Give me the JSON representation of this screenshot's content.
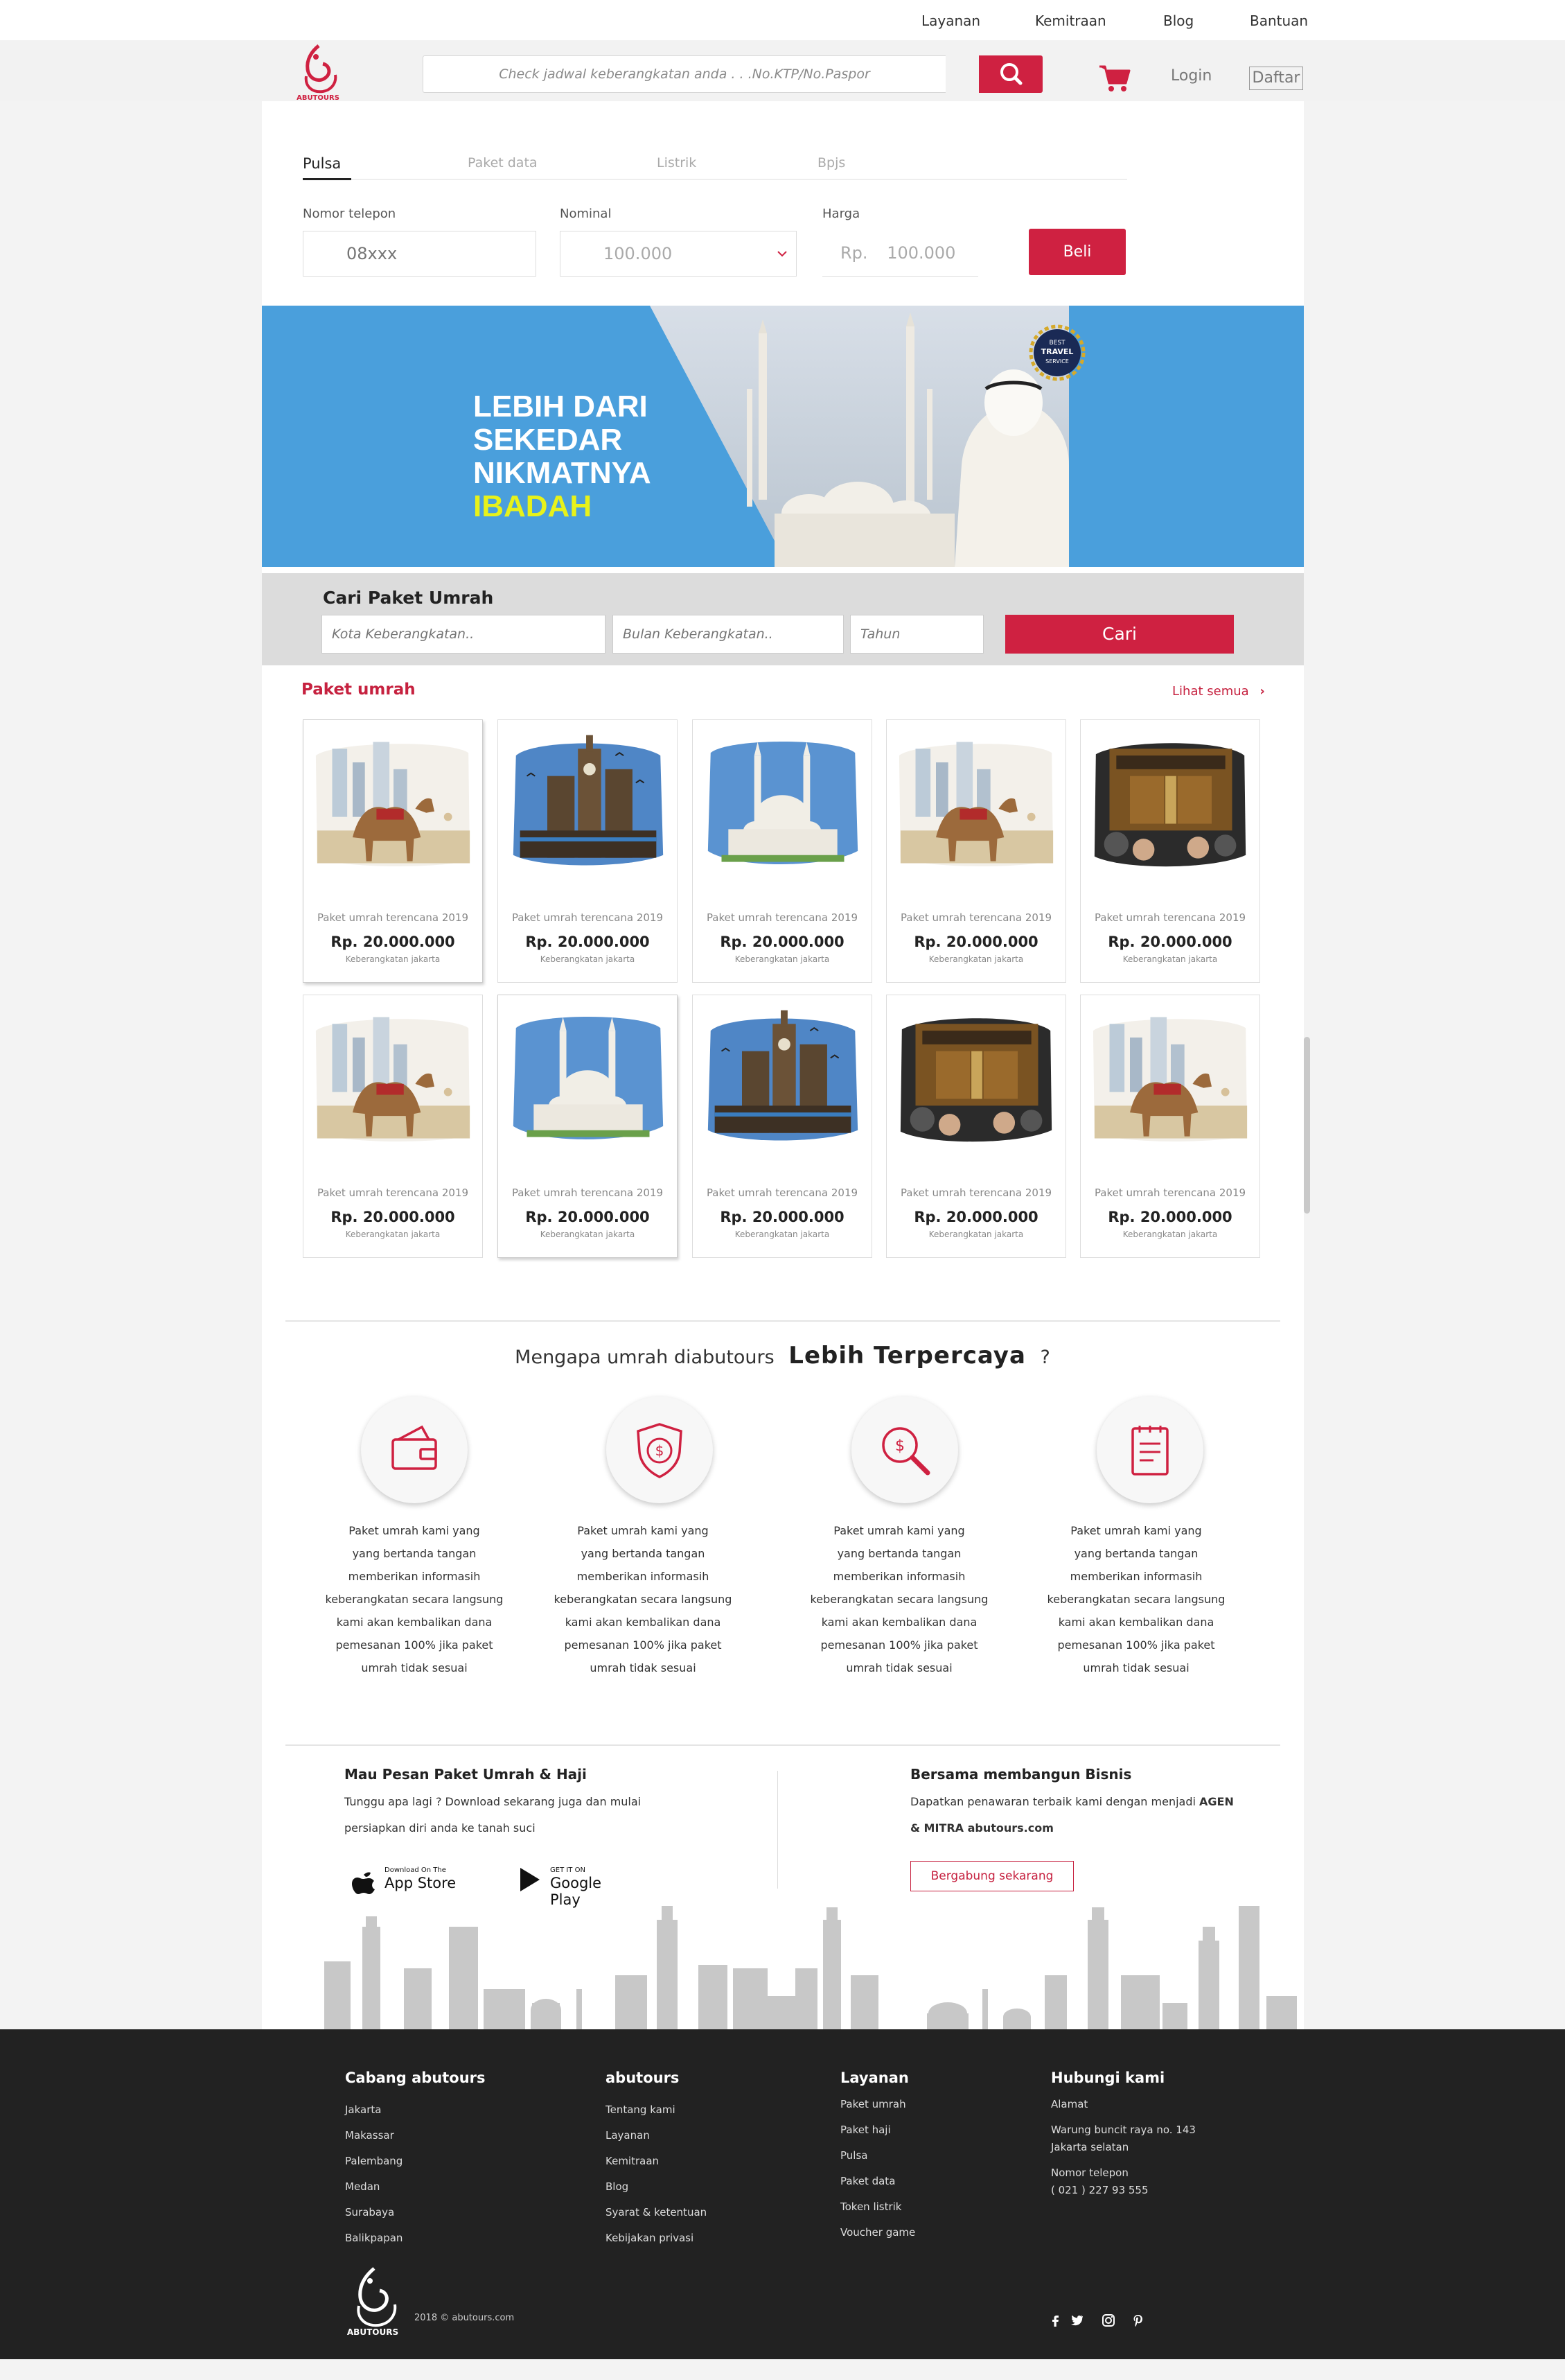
{
  "topnav": {
    "items": [
      "Layanan",
      "Kemitraan",
      "Blog",
      "Bantuan"
    ]
  },
  "header": {
    "search_placeholder": "Check jadwal keberangkatan anda . . .No.KTP/No.Paspor",
    "login": "Login",
    "daftar": "Daftar"
  },
  "pulsa": {
    "tabs": [
      "Pulsa",
      "Paket data",
      "Listrik",
      "Bpjs"
    ],
    "fields": {
      "phone_label": "Nomor telepon",
      "phone_placeholder": "08xxx",
      "nominal_label": "Nominal",
      "nominal_value": "100.000",
      "harga_label": "Harga",
      "harga_prefix": "Rp.",
      "harga_value": "100.000"
    },
    "buy": "Beli"
  },
  "banner": {
    "lines": [
      "LEBIH DARI",
      "SEKEDAR",
      "NIKMATNYA"
    ],
    "highlight": "IBADAH",
    "badge_top": "BEST",
    "badge_mid": "TRAVEL",
    "badge_bot": "SERVICE"
  },
  "search_paket": {
    "title": "Cari Paket Umrah",
    "kota_placeholder": "Kota Keberangkatan..",
    "bulan_placeholder": "Bulan Keberangkatan..",
    "tahun_placeholder": "Tahun",
    "button": "Cari"
  },
  "paket": {
    "title": "Paket umrah",
    "see_all": "Lihat semua",
    "cards": [
      {
        "title": "Paket umrah terencana 2019",
        "price": "Rp. 20.000.000",
        "departure": "Keberangkatan jakarta",
        "image": "camel"
      },
      {
        "title": "Paket umrah terencana 2019",
        "price": "Rp. 20.000.000",
        "departure": "Keberangkatan jakarta",
        "image": "clocktower"
      },
      {
        "title": "Paket umrah terencana 2019",
        "price": "Rp. 20.000.000",
        "departure": "Keberangkatan jakarta",
        "image": "mosque"
      },
      {
        "title": "Paket umrah terencana 2019",
        "price": "Rp. 20.000.000",
        "departure": "Keberangkatan jakarta",
        "image": "camel"
      },
      {
        "title": "Paket umrah terencana 2019",
        "price": "Rp. 20.000.000",
        "departure": "Keberangkatan jakarta",
        "image": "kaaba"
      },
      {
        "title": "Paket umrah terencana 2019",
        "price": "Rp. 20.000.000",
        "departure": "Keberangkatan jakarta",
        "image": "camel"
      },
      {
        "title": "Paket umrah terencana 2019",
        "price": "Rp. 20.000.000",
        "departure": "Keberangkatan jakarta",
        "image": "mosque"
      },
      {
        "title": "Paket umrah terencana 2019",
        "price": "Rp. 20.000.000",
        "departure": "Keberangkatan jakarta",
        "image": "clocktower"
      },
      {
        "title": "Paket umrah terencana 2019",
        "price": "Rp. 20.000.000",
        "departure": "Keberangkatan jakarta",
        "image": "kaaba"
      },
      {
        "title": "Paket umrah terencana 2019",
        "price": "Rp. 20.000.000",
        "departure": "Keberangkatan jakarta",
        "image": "camel"
      }
    ]
  },
  "why": {
    "prefix": "Mengapa umrah diabutours",
    "bold": "Lebih Terpercaya",
    "suffix": "?",
    "features": [
      {
        "icon": "wallet-icon",
        "lines": [
          "Paket umrah kami yang",
          "yang bertanda tangan",
          "memberikan informasih",
          "keberangkatan secara langsung",
          "kami akan kembalikan dana",
          "pemesanan 100% jika paket",
          "umrah tidak sesuai"
        ]
      },
      {
        "icon": "shield-dollar-icon",
        "lines": [
          "Paket umrah kami yang",
          "yang bertanda tangan",
          "memberikan informasih",
          "keberangkatan secara langsung",
          "kami akan kembalikan dana",
          "pemesanan 100% jika paket",
          "umrah tidak sesuai"
        ]
      },
      {
        "icon": "magnify-dollar-icon",
        "lines": [
          "Paket umrah kami yang",
          "yang bertanda tangan",
          "memberikan informasih",
          "keberangkatan secara langsung",
          "kami akan kembalikan dana",
          "pemesanan 100% jika paket",
          "umrah tidak sesuai"
        ]
      },
      {
        "icon": "document-icon",
        "lines": [
          "Paket umrah kami yang",
          "yang bertanda tangan",
          "memberikan informasih",
          "keberangkatan secara langsung",
          "kami akan kembalikan dana",
          "pemesanan 100% jika paket",
          "umrah tidak sesuai"
        ]
      }
    ]
  },
  "download": {
    "title": "Mau Pesan Paket Umrah & Haji",
    "line1": "Tunggu apa lagi ? Download sekarang juga dan mulai",
    "line2": "persiapkan diri anda ke tanah suci",
    "appstore_small": "Download On The",
    "appstore_big": "App Store",
    "gplay_small": "GET IT ON",
    "gplay_big": "Google Play"
  },
  "bisnis": {
    "title": "Bersama membangun Bisnis",
    "line1": "Dapatkan penawaran terbaik kami dengan menjadi",
    "line1_bold": "AGEN",
    "line2_bold": "& MITRA abutours.com",
    "button": "Bergabung sekarang"
  },
  "footer": {
    "cabang": {
      "title": "Cabang abutours",
      "items": [
        "Jakarta",
        "Makassar",
        "Palembang",
        "Medan",
        "Surabaya",
        "Balikpapan"
      ]
    },
    "abutours": {
      "title": "abutours",
      "items": [
        "Tentang kami",
        "Layanan",
        "Kemitraan",
        "Blog",
        "Syarat & ketentuan",
        "Kebijakan privasi"
      ]
    },
    "layanan": {
      "title": "Layanan",
      "items": [
        "Paket umrah",
        "Paket haji",
        "Pulsa",
        "Paket data",
        "Token listrik",
        "Voucher game"
      ]
    },
    "hubungi": {
      "title": "Hubungi kami",
      "alamat_label": "Alamat",
      "alamat1": "Warung buncit raya no. 143",
      "alamat2": "Jakarta selatan",
      "phone_label": "Nomor telepon",
      "phone": "( 021 )  227 93 555"
    },
    "copyright": "2018 © abutours.com",
    "logo_text": "ABUTOURS",
    "social": [
      "facebook-icon",
      "twitter-icon",
      "instagram-icon",
      "pinterest-icon"
    ]
  },
  "colors": {
    "accent": "#cf2141",
    "banner": "#4a9fdc",
    "footer": "#222222",
    "highlight": "#e7f21a"
  }
}
